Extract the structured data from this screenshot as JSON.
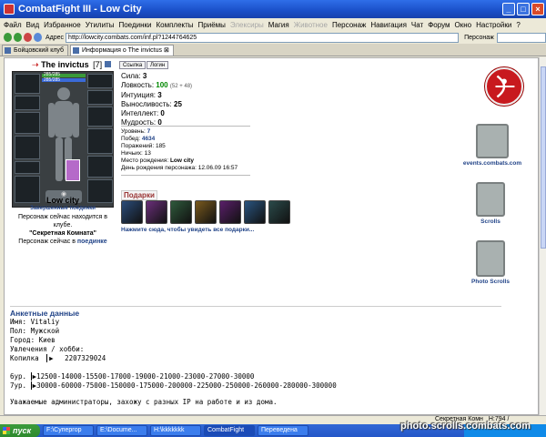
{
  "window": {
    "title": "CombatFight III - Low City"
  },
  "menu": [
    "Файл",
    "Вид",
    "Избранное",
    "Утилиты",
    "Поединки",
    "Комплекты",
    "Приёмы",
    "Элексиры",
    "Магия",
    "Животное",
    "Персонаж",
    "Навигация",
    "Чат",
    "Форум",
    "Окно",
    "Настройки",
    "?"
  ],
  "menu_disabled": [
    "Элексиры",
    "Животное"
  ],
  "address": {
    "label": "Адрес",
    "url": "http://lowcity.combats.com/inf.pl?1244764625",
    "search_label": "Персонаж"
  },
  "tabs": [
    {
      "label": "Бойцовский клуб"
    },
    {
      "label": "Информация о The invictus"
    }
  ],
  "character": {
    "name": "The invictus",
    "level": "[7]",
    "btn_links": "Ссылка",
    "btn_login": "Логин",
    "hp": "285/285",
    "mana": "285/285"
  },
  "location": {
    "city": "Low city",
    "subtitle": "Завершенные поединки",
    "text1": "Персонаж сейчас находится в клубе.",
    "room": "\"Секретная Комната\"",
    "text2": "Персонаж сейчас в",
    "fight_link": "поединке"
  },
  "stats": [
    {
      "label": "Сила:",
      "value": "3"
    },
    {
      "label": "Ловкость:",
      "value": "100",
      "bonus": "(52 + 48)"
    },
    {
      "label": "Интуиция:",
      "value": "3"
    },
    {
      "label": "Выносливость:",
      "value": "25"
    },
    {
      "label": "Интеллект:",
      "value": "0"
    },
    {
      "label": "Мудрость:",
      "value": "0"
    }
  ],
  "records": {
    "level_label": "Уровень:",
    "level": "7",
    "wins_label": "Побед:",
    "wins": "4634",
    "losses_label": "Поражений:",
    "losses": "185",
    "draws_label": "Ничьих:",
    "draws": "13",
    "birthplace_label": "Место рождения:",
    "birthplace": "Low city",
    "birthday_label": "День рождения персонажа:",
    "birthday": "12.06.09 16:57"
  },
  "gifts": {
    "title": "Подарки",
    "link": "Нажмите сюда, чтобы увидеть все подарки...",
    "colors": [
      "#2b4c7a",
      "#6a2f7a",
      "#2f5a3c",
      "#7a5a1e",
      "#5a1f6a",
      "#2a5580",
      "#2a4a4a"
    ]
  },
  "sidebar": {
    "events": "events.combats.com",
    "scrolls": "Scrolls",
    "photo": "Photo Scrolls"
  },
  "profile": {
    "title": "Анкетные данные",
    "name": "Имя: Vitaliy",
    "sex": "Пол: Мужской",
    "city": "Город: Киев",
    "hobby": "Увлечения / хобби:",
    "wallet_label": "Копилка",
    "wallet": "2207329024"
  },
  "levels": [
    {
      "lvl": "6ур.",
      "values": "12500-14000-15500-17000-19000-21000-23000-27000-30000"
    },
    {
      "lvl": "7ур.",
      "values": "30000-60000-75000-150000-175000-200000-225000-250000-260000-280000-300000"
    }
  ],
  "note": "Уважаемые администраторы, захожу с разных IP на работе и из  дома.",
  "status": {
    "tab": "Секретная Комн",
    "hp": "H:794 /"
  },
  "taskbar": {
    "start": "пуск",
    "tasks": [
      "F:\\Супергор",
      "E:\\Docume...",
      "H:\\kkkkkkk",
      "CombatFight",
      "Переведена"
    ],
    "tray": ""
  },
  "watermark": "photo.scrolls.combats.com"
}
